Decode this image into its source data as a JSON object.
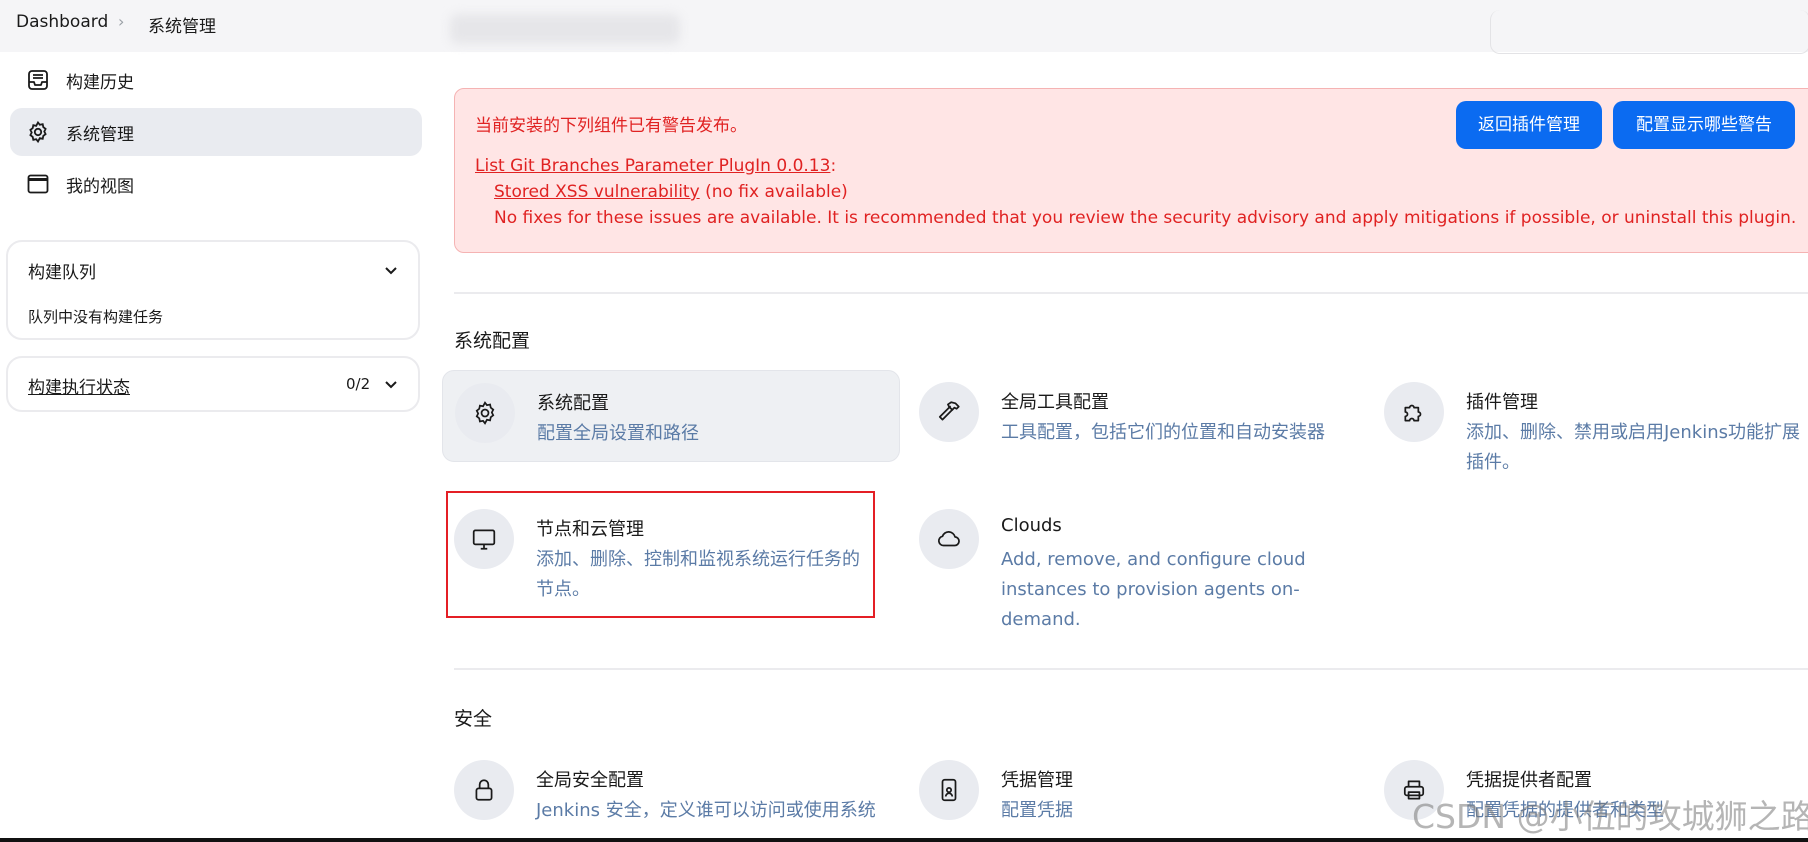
{
  "breadcrumb": {
    "home": "Dashboard",
    "current": "系统管理"
  },
  "sidebar": {
    "items": [
      {
        "label": "构建历史",
        "icon": "inbox-icon"
      },
      {
        "label": "系统管理",
        "icon": "gear-icon",
        "active": true
      },
      {
        "label": "我的视图",
        "icon": "window-icon"
      }
    ],
    "build_queue": {
      "title": "构建队列",
      "empty": "队列中没有构建任务"
    },
    "executors": {
      "title": "构建执行状态",
      "count": "0/2"
    }
  },
  "warning": {
    "heading": "当前安装的下列组件已有警告发布。",
    "plugin_link": "List Git Branches Parameter PlugIn 0.0.13",
    "colon": ":",
    "vuln_link": "Stored XSS vulnerability",
    "vuln_note": "(no fix available)",
    "advice": "No fixes for these issues are available. It is recommended that you review the security advisory and apply mitigations if possible, or uninstall this plugin.",
    "buttons": {
      "back": "返回插件管理",
      "configure": "配置显示哪些警告"
    },
    "colors": {
      "background": "#ffe5e5",
      "text": "#e02222",
      "button": "#0b6bf1"
    }
  },
  "sections": {
    "system_config": {
      "title": "系统配置",
      "tiles": [
        {
          "title": "系统配置",
          "desc": "配置全局设置和路径",
          "icon": "gear-icon"
        },
        {
          "title": "全局工具配置",
          "desc": "工具配置，包括它们的位置和自动安装器",
          "icon": "hammer-icon"
        },
        {
          "title": "插件管理",
          "desc": "添加、删除、禁用或启用Jenkins功能扩展插件。",
          "icon": "puzzle-icon"
        },
        {
          "title": "节点和云管理",
          "desc": "添加、删除、控制和监视系统运行任务的节点。",
          "icon": "monitor-icon"
        },
        {
          "title": "Clouds",
          "desc": "Add, remove, and configure cloud instances to provision agents on-demand.",
          "icon": "cloud-icon"
        }
      ]
    },
    "security": {
      "title": "安全",
      "tiles": [
        {
          "title": "全局安全配置",
          "desc": "Jenkins 安全，定义谁可以访问或使用系统",
          "icon": "lock-icon"
        },
        {
          "title": "凭据管理",
          "desc": "配置凭据",
          "icon": "id-badge-icon"
        },
        {
          "title": "凭据提供者配置",
          "desc": "配置凭据的提供者和类型",
          "icon": "printer-icon"
        }
      ]
    }
  },
  "watermark": "CSDN @小伍的攻城狮之路"
}
